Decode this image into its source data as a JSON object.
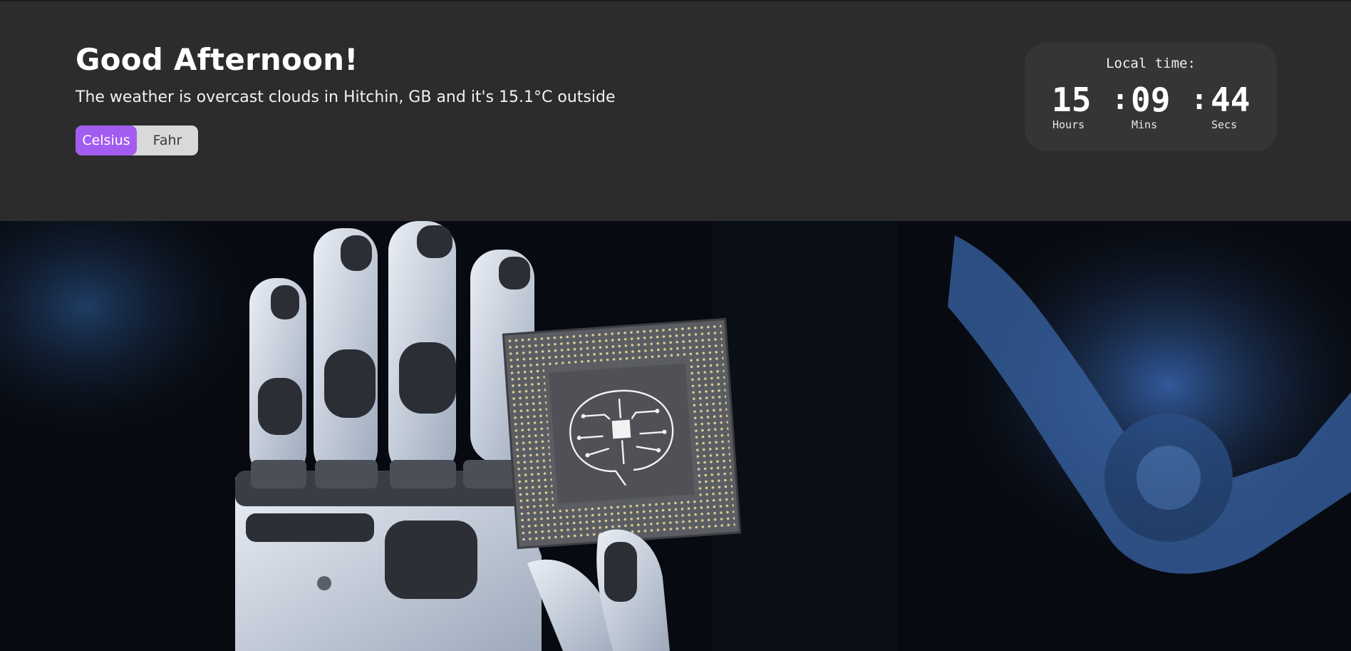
{
  "header": {
    "greeting": "Good Afternoon!",
    "weather": "The weather is overcast clouds in Hitchin, GB and it's 15.1°C outside",
    "units": {
      "celsius": "Celsius",
      "fahr": "Fahr",
      "selected": "Celsius"
    }
  },
  "clock": {
    "label": "Local time:",
    "hours": "15",
    "mins": "09",
    "secs": "44",
    "separator": ":",
    "hours_label": "Hours",
    "mins_label": "Mins",
    "secs_label": "Secs"
  },
  "colors": {
    "accent": "#a35cf0",
    "header_bg": "#2c2c2c",
    "clock_bg": "#353535",
    "toggle_bg": "#d9d9d9"
  },
  "hero": {
    "image_subject": "robot hand holding processor chip with brain circuit"
  }
}
